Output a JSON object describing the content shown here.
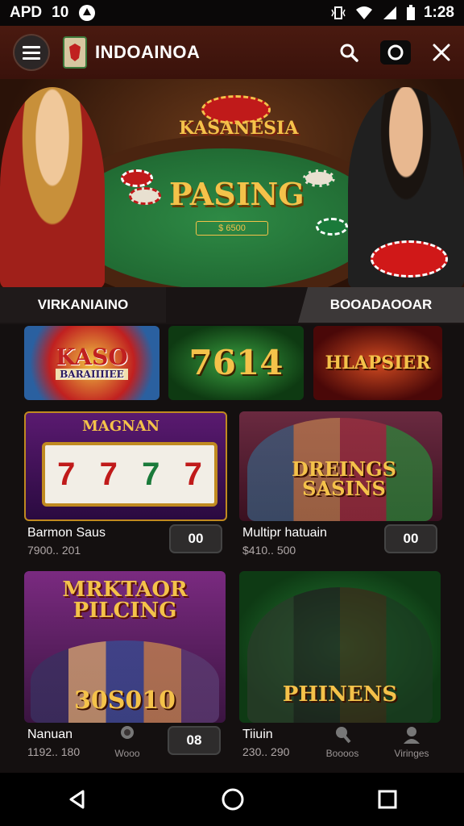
{
  "status": {
    "carrier": "APD",
    "notif_count": "10",
    "time": "1:28"
  },
  "appbar": {
    "title": "INDOAINOA"
  },
  "hero": {
    "sign": "KASANESIA",
    "brand": "PASING",
    "plaque": "$ 6500"
  },
  "tabs": {
    "left": "VIRKANIAINO",
    "right": "BOOADAOOAR"
  },
  "banners": [
    {
      "line1": "KASO",
      "line2": "BARAIIIIEE"
    },
    {
      "line1": "7614"
    },
    {
      "line1": "HLAPSIER"
    }
  ],
  "cards": [
    {
      "poster": "MAGNAN",
      "title": "Barmon Saus",
      "sub": "7900.. 201",
      "pill": "00"
    },
    {
      "poster": "DREINGS SASINS",
      "title": "Multipr hatuain",
      "sub": "$410.. 500",
      "pill": "00"
    },
    {
      "poster": "MRKTAOR PILCING",
      "amount": "30S010",
      "title": "Nanuan",
      "sub": "1192.. 180",
      "pill": "08"
    },
    {
      "poster": "PHINENS",
      "title": "Tiiuin",
      "sub": "230.. 290"
    }
  ],
  "bottom_icons": [
    {
      "label": "Wooo"
    },
    {
      "label": "Boooos"
    },
    {
      "label": "Viringes"
    }
  ],
  "colors": {
    "appbar": "#3a120b",
    "felt": "#1b5e2c",
    "gold": "#f4c24a",
    "tab_active": "#3c3838"
  }
}
